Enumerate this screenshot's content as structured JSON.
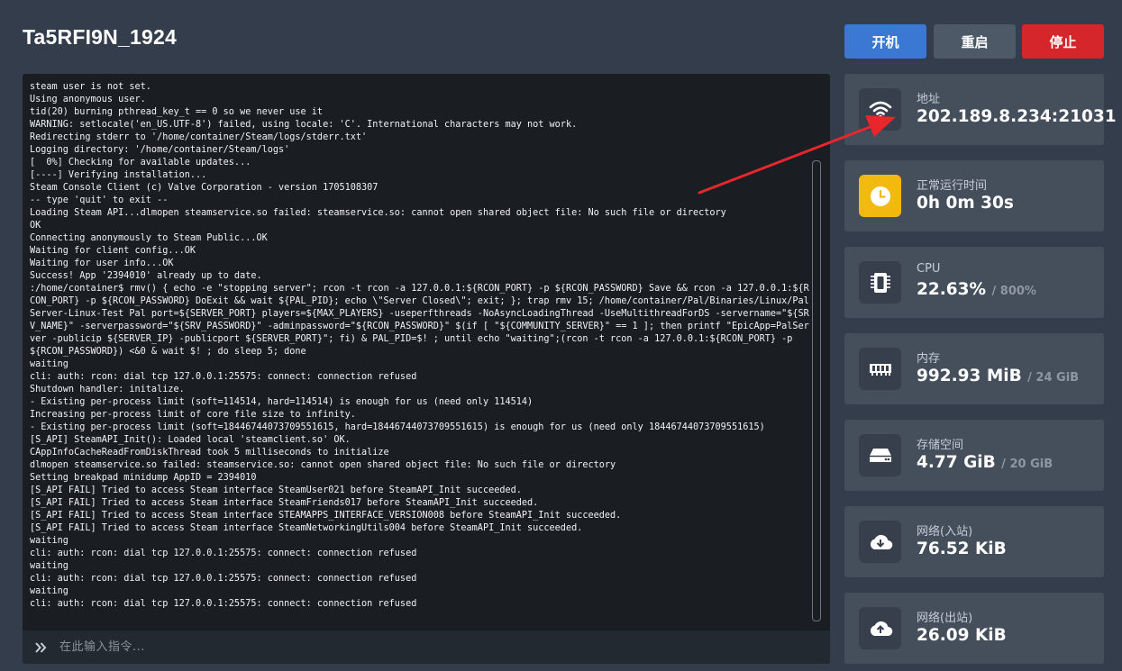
{
  "server": {
    "name": "Ta5RFI9N_1924"
  },
  "controls": {
    "start_label": "开机",
    "restart_label": "重启",
    "stop_label": "停止"
  },
  "console": {
    "log": "steam user is not set.\nUsing anonymous user.\ntid(20) burning pthread_key_t == 0 so we never use it\nWARNING: setlocale('en_US.UTF-8') failed, using locale: 'C'. International characters may not work.\nRedirecting stderr to '/home/container/Steam/logs/stderr.txt'\nLogging directory: '/home/container/Steam/logs'\n[  0%] Checking for available updates...\n[----] Verifying installation...\nSteam Console Client (c) Valve Corporation - version 1705108307\n-- type 'quit' to exit --\nLoading Steam API...dlmopen steamservice.so failed: steamservice.so: cannot open shared object file: No such file or directory\nOK\nConnecting anonymously to Steam Public...OK\nWaiting for client config...OK\nWaiting for user info...OK\nSuccess! App '2394010' already up to date.\n:/home/container$ rmv() { echo -e \"stopping server\"; rcon -t rcon -a 127.0.0.1:${RCON_PORT} -p ${RCON_PASSWORD} Save && rcon -a 127.0.0.1:${RCON_PORT} -p ${RCON_PASSWORD} DoExit && wait ${PAL_PID}; echo \\\"Server Closed\\\"; exit; }; trap rmv 15; /home/container/Pal/Binaries/Linux/PalServer-Linux-Test Pal port=${SERVER_PORT} players=${MAX_PLAYERS} -useperfthreads -NoAsyncLoadingThread -UseMultithreadForDS -servername=\"${SRV_NAME}\" -serverpassword=\"${SRV_PASSWORD}\" -adminpassword=\"${RCON_PASSWORD}\" $(if [ \"${COMMUNITY_SERVER}\" == 1 ]; then printf \"EpicApp=PalServer -publicip ${SERVER_IP} -publicport ${SERVER_PORT}\"; fi) & PAL_PID=$! ; until echo \"waiting\";(rcon -t rcon -a 127.0.0.1:${RCON_PORT} -p ${RCON_PASSWORD}) <&0 & wait $! ; do sleep 5; done\nwaiting\ncli: auth: rcon: dial tcp 127.0.0.1:25575: connect: connection refused\nShutdown handler: initalize.\n- Existing per-process limit (soft=114514, hard=114514) is enough for us (need only 114514)\nIncreasing per-process limit of core file size to infinity.\n- Existing per-process limit (soft=18446744073709551615, hard=18446744073709551615) is enough for us (need only 18446744073709551615)\n[S_API] SteamAPI_Init(): Loaded local 'steamclient.so' OK.\nCAppInfoCacheReadFromDiskThread took 5 milliseconds to initialize\ndlmopen steamservice.so failed: steamservice.so: cannot open shared object file: No such file or directory\nSetting breakpad minidump AppID = 2394010\n[S_API FAIL] Tried to access Steam interface SteamUser021 before SteamAPI_Init succeeded.\n[S_API FAIL] Tried to access Steam interface SteamFriends017 before SteamAPI_Init succeeded.\n[S_API FAIL] Tried to access Steam interface STEAMAPPS_INTERFACE_VERSION008 before SteamAPI_Init succeeded.\n[S_API FAIL] Tried to access Steam interface SteamNetworkingUtils004 before SteamAPI_Init succeeded.\nwaiting\ncli: auth: rcon: dial tcp 127.0.0.1:25575: connect: connection refused\nwaiting\ncli: auth: rcon: dial tcp 127.0.0.1:25575: connect: connection refused\nwaiting\ncli: auth: rcon: dial tcp 127.0.0.1:25575: connect: connection refused",
    "input_placeholder": "在此输入指令...",
    "prompt_icon": "double-chevron-right-icon"
  },
  "stats": {
    "address": {
      "label": "地址",
      "value": "202.189.8.234:21031",
      "icon": "wifi-icon"
    },
    "uptime": {
      "label": "正常运行时间",
      "value": "0h 0m 30s",
      "icon": "clock-icon",
      "icon_bg": "#f2b90f"
    },
    "cpu": {
      "label": "CPU",
      "value": "22.63%",
      "limit": "/ 800%",
      "icon": "cpu-chip-icon"
    },
    "memory": {
      "label": "内存",
      "value": "992.93 MiB",
      "limit": "/ 24 GiB",
      "icon": "memory-icon"
    },
    "storage": {
      "label": "存储空间",
      "value": "4.77 GiB",
      "limit": "/ 20 GiB",
      "icon": "hard-drive-icon"
    },
    "net_in": {
      "label": "网络(入站)",
      "value": "76.52 KiB",
      "icon": "cloud-download-icon"
    },
    "net_out": {
      "label": "网络(出站)",
      "value": "26.09 KiB",
      "icon": "cloud-upload-icon"
    }
  },
  "annotation": {
    "color": "#e8262c",
    "shape": "red-arrow",
    "points_to": "address"
  },
  "colors": {
    "start": "#3a78d4",
    "restart": "#4e5968",
    "stop": "#d5262b",
    "background": "#333d4b",
    "card": "#454f5c",
    "console": "#1a1e23"
  }
}
